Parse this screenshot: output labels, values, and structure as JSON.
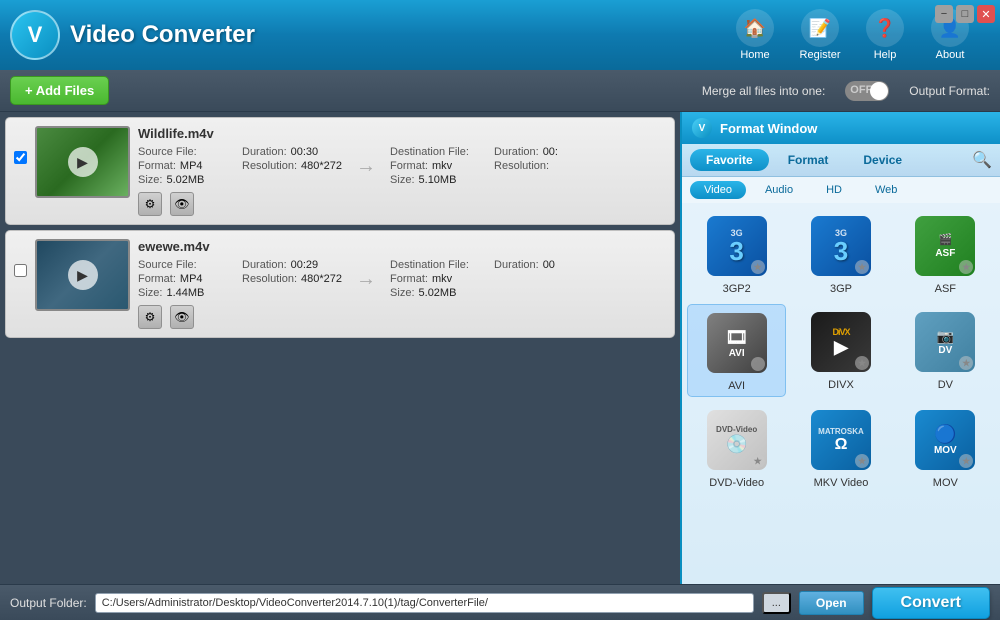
{
  "app": {
    "title": "Video Converter",
    "logo_letter": "V"
  },
  "nav": {
    "home": "Home",
    "register": "Register",
    "help": "Help",
    "about": "About"
  },
  "toolbar": {
    "add_files": "+ Add Files",
    "merge_label": "Merge all files into one:",
    "toggle_state": "OFF",
    "output_format_label": "Output Format:"
  },
  "files": [
    {
      "name": "Wildlife.m4v",
      "source_label": "Source File:",
      "format_label": "Format:",
      "format_val": "MP4",
      "duration_label": "Duration:",
      "duration_val": "00:30",
      "size_label": "Size:",
      "size_val": "5.02MB",
      "resolution_label": "Resolution:",
      "resolution_val": "480*272",
      "dest_label": "Destination File:",
      "dest_format_label": "Format:",
      "dest_format_val": "mkv",
      "dest_duration_label": "Duration:",
      "dest_duration_val": "00:",
      "dest_size_label": "Size:",
      "dest_size_val": "5.10MB",
      "dest_resolution_label": "Resolution:",
      "dest_resolution_val": ""
    },
    {
      "name": "ewewe.m4v",
      "source_label": "Source File:",
      "format_label": "Format:",
      "format_val": "MP4",
      "duration_label": "Duration:",
      "duration_val": "00:29",
      "size_label": "Size:",
      "size_val": "1.44MB",
      "resolution_label": "Resolution:",
      "resolution_val": "480*272",
      "dest_label": "Destination File:",
      "dest_format_label": "Format:",
      "dest_format_val": "mkv",
      "dest_duration_label": "Duration:",
      "dest_duration_val": "00",
      "dest_size_label": "Size:",
      "dest_size_val": "5.02MB",
      "dest_resolution_label": "Resolution:",
      "dest_resolution_val": ""
    }
  ],
  "format_window": {
    "title": "Format Window",
    "tabs": [
      "Favorite",
      "Format",
      "Device"
    ],
    "active_tab": "Favorite",
    "subtabs": [
      "Video",
      "Audio",
      "HD",
      "Web"
    ],
    "active_subtab": "Video",
    "formats": [
      {
        "id": "3gp2",
        "name": "3GP-2",
        "label": "3GP2"
      },
      {
        "id": "3gp",
        "name": "3GP",
        "label": "3GP"
      },
      {
        "id": "asf",
        "name": "ASF",
        "label": "ASF"
      },
      {
        "id": "avi",
        "name": "AVI",
        "label": "AVI"
      },
      {
        "id": "divx",
        "name": "DIVX",
        "label": "DIVX"
      },
      {
        "id": "dv",
        "name": "DV",
        "label": "DV"
      },
      {
        "id": "dvd",
        "name": "DVD-Video",
        "label": "DVD-Video"
      },
      {
        "id": "mkv",
        "name": "MKV Video",
        "label": "MKV"
      },
      {
        "id": "mov",
        "name": "MOV",
        "label": "MOV"
      }
    ]
  },
  "status_bar": {
    "output_label": "Output Folder:",
    "output_path": "C:/Users/Administrator/Desktop/VideoConverter2014.7.10(1)/tag/ConverterFile/",
    "browse_btn": "...",
    "open_btn": "Open",
    "convert_btn": "Convert"
  }
}
